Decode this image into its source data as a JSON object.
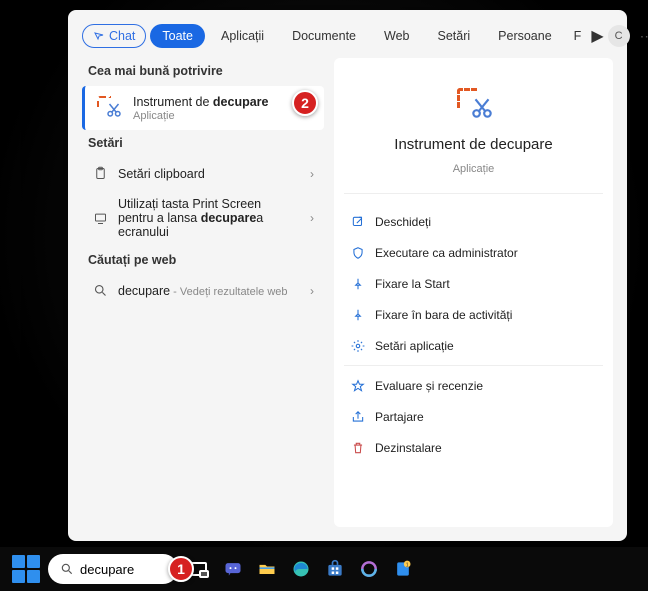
{
  "tabs": {
    "chat": "Chat",
    "all": "Toate",
    "apps": "Aplicații",
    "documents": "Documente",
    "web": "Web",
    "settings": "Setări",
    "people": "Persoane",
    "trunc": "F",
    "avatar_initial": "C"
  },
  "sections": {
    "best": "Cea mai bună potrivire",
    "settings": "Setări",
    "web": "Căutați pe web"
  },
  "best_match": {
    "title_pre": "Instrument de ",
    "title_bold": "decupare",
    "subtitle": "Aplicație"
  },
  "settings_rows": {
    "clipboard": "Setări clipboard",
    "printscreen_pre": "Utilizați tasta Print Screen pentru a lansa ",
    "printscreen_bold": "decupare",
    "printscreen_post": "a ecranului"
  },
  "web_rows": {
    "query": "decupare",
    "suffix": " - Vedeți rezultatele web"
  },
  "detail": {
    "title": "Instrument de decupare",
    "subtitle": "Aplicație",
    "actions": {
      "open": "Deschideți",
      "admin": "Executare ca administrator",
      "pin_start": "Fixare la Start",
      "pin_taskbar": "Fixare în bara de activități",
      "app_settings": "Setări aplicație",
      "review": "Evaluare și recenzie",
      "share": "Partajare",
      "uninstall": "Dezinstalare"
    }
  },
  "taskbar": {
    "search_value": "decupare"
  },
  "callouts": {
    "one": "1",
    "two": "2"
  }
}
